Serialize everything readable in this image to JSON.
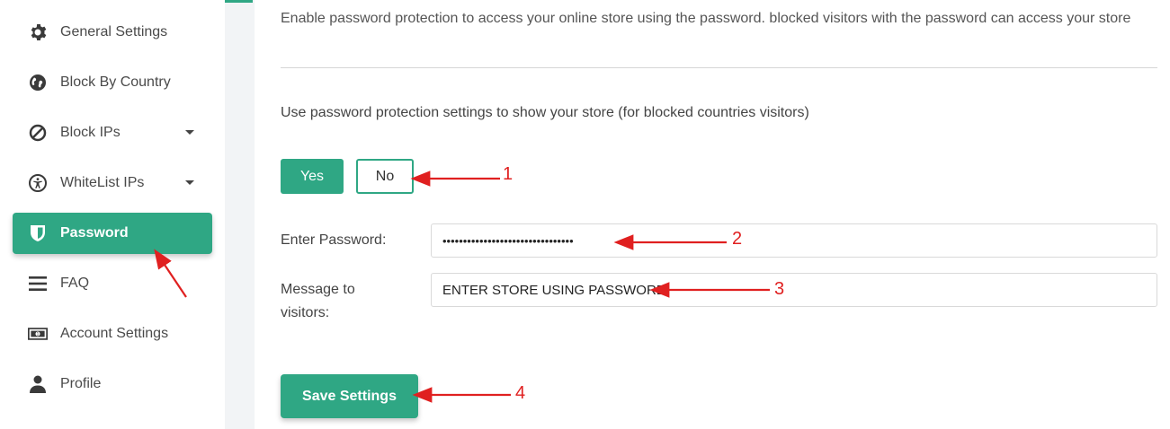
{
  "sidebar": {
    "items": [
      {
        "label": "General Settings",
        "icon": "gear-icon"
      },
      {
        "label": "Block By Country",
        "icon": "globe-icon"
      },
      {
        "label": "Block IPs",
        "icon": "ban-icon",
        "has_dropdown": true
      },
      {
        "label": "WhiteList IPs",
        "icon": "accessibility-icon",
        "has_dropdown": true
      },
      {
        "label": "Password",
        "icon": "shield-icon",
        "active": true
      },
      {
        "label": "FAQ",
        "icon": "menu-icon"
      },
      {
        "label": "Account Settings",
        "icon": "money-icon"
      },
      {
        "label": "Profile",
        "icon": "user-icon"
      }
    ]
  },
  "main": {
    "description": "Enable password protection to access your online store using the password. blocked visitors with the password can access your store",
    "question": "Use password protection settings to show your store (for blocked countries visitors)",
    "toggle": {
      "yes_label": "Yes",
      "no_label": "No",
      "selected": "Yes"
    },
    "password_label": "Enter Password:",
    "password_value": "••••••••••••••••••••••••••••••••",
    "message_label": "Message to visitors:",
    "message_value": "ENTER STORE USING PASSWORD",
    "save_label": "Save Settings"
  },
  "annotations": [
    "1",
    "2",
    "3",
    "4"
  ],
  "colors": {
    "accent": "#2fa784",
    "annotation": "#e02020"
  }
}
